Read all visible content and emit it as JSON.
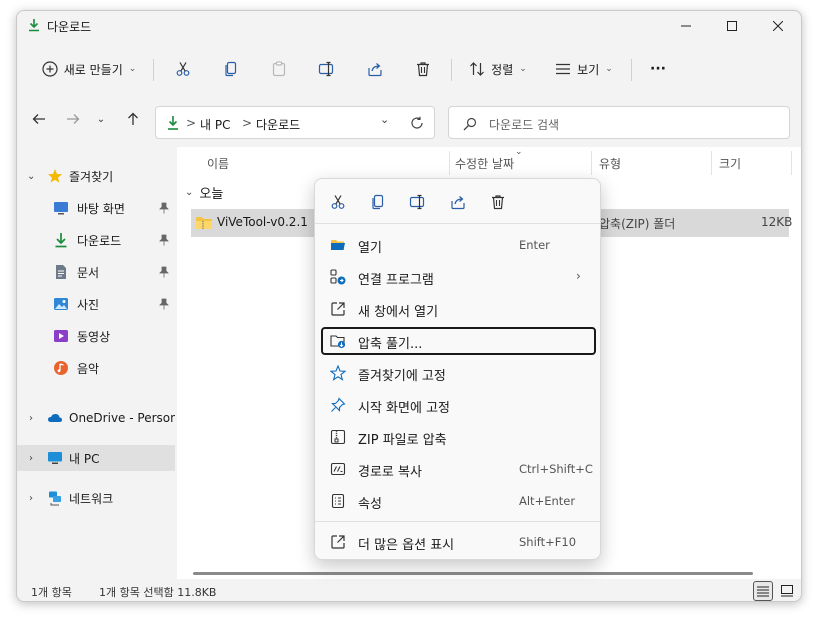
{
  "window": {
    "title": "다운로드"
  },
  "toolbar": {
    "new_label": "새로 만들기",
    "sort_label": "정렬",
    "view_label": "보기",
    "more_label": "···"
  },
  "address": {
    "segments": [
      "내 PC",
      "다운로드"
    ],
    "separator": ">"
  },
  "search": {
    "placeholder": "다운로드 검색"
  },
  "sidebar": {
    "quick_access": "즐겨찾기",
    "items": [
      {
        "label": "바탕 화면",
        "icon": "desktop-icon"
      },
      {
        "label": "다운로드",
        "icon": "download-icon"
      },
      {
        "label": "문서",
        "icon": "document-icon"
      },
      {
        "label": "사진",
        "icon": "pictures-icon"
      },
      {
        "label": "동영상",
        "icon": "videos-icon"
      },
      {
        "label": "음악",
        "icon": "music-icon"
      }
    ],
    "onedrive": "OneDrive - Persona",
    "this_pc": "내 PC",
    "network": "네트워크"
  },
  "columns": {
    "name": "이름",
    "date": "수정한 날짜",
    "type": "유형",
    "size": "크기"
  },
  "group": {
    "label": "오늘"
  },
  "file": {
    "name": "ViVeTool-v0.2.1",
    "type": "압축(ZIP) 폴더",
    "size": "12KB"
  },
  "status": {
    "count": "1개 항목",
    "selected": "1개 항목 선택함 11.8KB"
  },
  "context_menu": {
    "items": [
      {
        "label": "열기",
        "shortcut": "Enter",
        "icon": "folder-open-icon"
      },
      {
        "label": "연결 프로그램",
        "shortcut": "",
        "icon": "open-with-icon"
      },
      {
        "label": "새 창에서 열기",
        "shortcut": "",
        "icon": "new-window-icon"
      },
      {
        "label": "압축 풀기...",
        "shortcut": "",
        "icon": "extract-icon"
      },
      {
        "label": "즐겨찾기에 고정",
        "shortcut": "",
        "icon": "star-icon"
      },
      {
        "label": "시작 화면에 고정",
        "shortcut": "",
        "icon": "pin-icon"
      },
      {
        "label": "ZIP 파일로 압축",
        "shortcut": "",
        "icon": "zip-icon"
      },
      {
        "label": "경로로 복사",
        "shortcut": "Ctrl+Shift+C",
        "icon": "copy-path-icon"
      },
      {
        "label": "속성",
        "shortcut": "Alt+Enter",
        "icon": "properties-icon"
      },
      {
        "label": "더 많은 옵션 표시",
        "shortcut": "Shift+F10",
        "icon": "more-options-icon"
      }
    ]
  },
  "colors": {
    "accent": "#0067c0",
    "download_green": "#1a8c3c",
    "folder_yellow": "#f5c342"
  }
}
